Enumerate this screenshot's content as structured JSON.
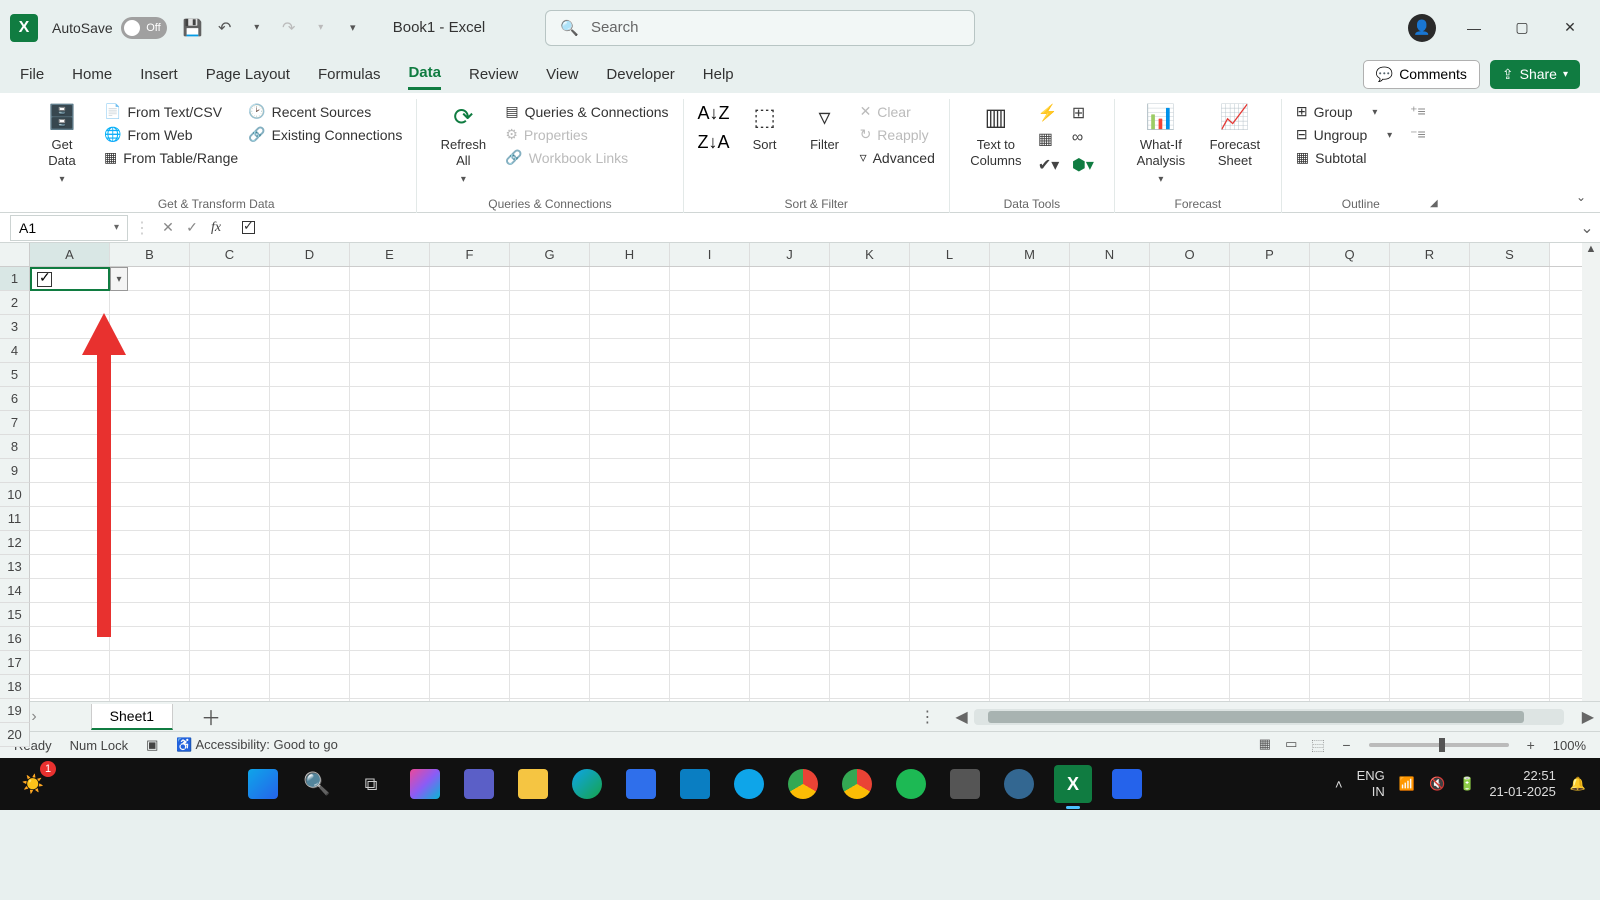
{
  "title_bar": {
    "autosave_label": "AutoSave",
    "autosave_state": "Off",
    "doc_title": "Book1  -  Excel",
    "search_placeholder": "Search"
  },
  "window_controls": {
    "minimize": "—",
    "maximize": "▢",
    "close": "✕"
  },
  "ribbon_tabs": [
    "File",
    "Home",
    "Insert",
    "Page Layout",
    "Formulas",
    "Data",
    "Review",
    "View",
    "Developer",
    "Help"
  ],
  "active_tab": "Data",
  "ribbon_right": {
    "comments": "Comments",
    "share": "Share"
  },
  "ribbon": {
    "get_transform": {
      "get_data": "Get\nData",
      "from_text_csv": "From Text/CSV",
      "from_web": "From Web",
      "from_table_range": "From Table/Range",
      "recent_sources": "Recent Sources",
      "existing_connections": "Existing Connections",
      "group_label": "Get & Transform Data"
    },
    "queries": {
      "refresh_all": "Refresh\nAll",
      "queries_connections": "Queries & Connections",
      "properties": "Properties",
      "workbook_links": "Workbook Links",
      "group_label": "Queries & Connections"
    },
    "sort_filter": {
      "sort": "Sort",
      "filter": "Filter",
      "clear": "Clear",
      "reapply": "Reapply",
      "advanced": "Advanced",
      "group_label": "Sort & Filter"
    },
    "data_tools": {
      "text_to_columns": "Text to\nColumns",
      "group_label": "Data Tools"
    },
    "forecast": {
      "whatif": "What-If\nAnalysis",
      "forecast_sheet": "Forecast\nSheet",
      "group_label": "Forecast"
    },
    "outline": {
      "group": "Group",
      "ungroup": "Ungroup",
      "subtotal": "Subtotal",
      "group_label": "Outline"
    }
  },
  "formula_bar": {
    "name_box": "A1",
    "content_glyph": "checkbox-checked"
  },
  "grid": {
    "columns": [
      "A",
      "B",
      "C",
      "D",
      "E",
      "F",
      "G",
      "H",
      "I",
      "J",
      "K",
      "L",
      "M",
      "N",
      "O",
      "P",
      "Q",
      "R",
      "S"
    ],
    "rows": [
      1,
      2,
      3,
      4,
      5,
      6,
      7,
      8,
      9,
      10,
      11,
      12,
      13,
      14,
      15,
      16,
      17,
      18,
      19,
      20
    ],
    "active_cell": "A1",
    "a1_value_kind": "checkbox-checked",
    "a1_has_filter_dropdown": true
  },
  "sheet_bar": {
    "sheets": [
      "Sheet1"
    ],
    "active_sheet": "Sheet1"
  },
  "status_bar": {
    "ready": "Ready",
    "num_lock": "Num Lock",
    "accessibility": "Accessibility: Good to go",
    "zoom": "100%"
  },
  "taskbar": {
    "lang_top": "ENG",
    "lang_bottom": "IN",
    "time": "22:51",
    "date": "21-01-2025"
  },
  "annotation": {
    "type": "red-up-arrow",
    "points_to": "cell A1"
  }
}
